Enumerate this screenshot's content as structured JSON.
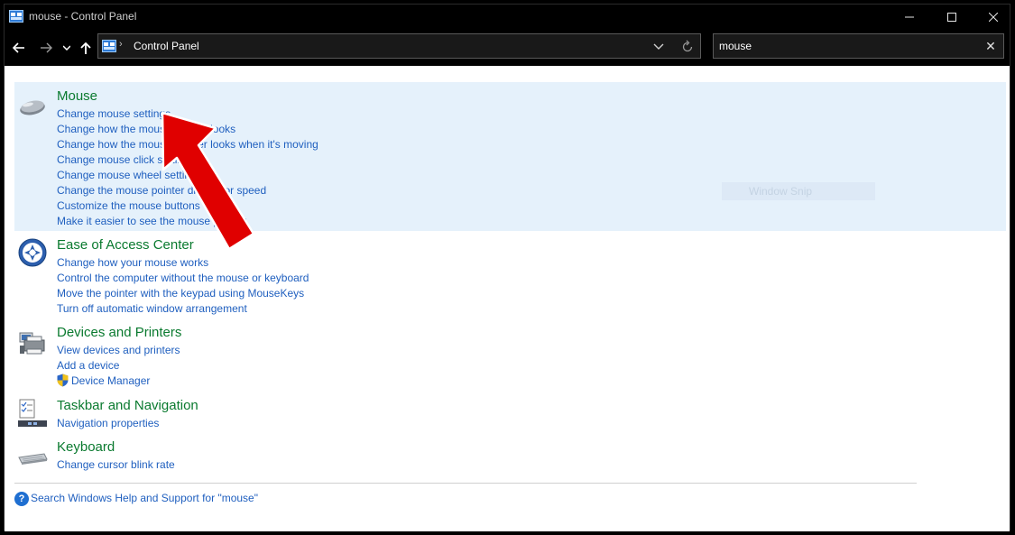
{
  "window": {
    "title": "mouse - Control Panel",
    "accent": "#000000"
  },
  "navbar": {
    "address": "Control Panel",
    "search_value": "mouse",
    "icons": [
      "back-arrow-icon",
      "forward-arrow-icon",
      "chevron-down-icon",
      "up-arrow-icon",
      "control-panel-icon",
      "refresh-icon",
      "close-icon"
    ]
  },
  "results": [
    {
      "title": "Mouse",
      "icon": "mouse-icon",
      "links": [
        "Change mouse settings",
        "Change how the mouse pointer looks",
        "Change how the mouse pointer looks when it's moving",
        "Change mouse click settings",
        "Change mouse wheel settings",
        "Change the mouse pointer display or speed",
        "Customize the mouse buttons",
        "Make it easier to see the mouse pointer"
      ]
    },
    {
      "title": "Ease of Access Center",
      "icon": "ease-of-access-icon",
      "links": [
        "Change how your mouse works",
        "Control the computer without the mouse or keyboard",
        "Move the pointer with the keypad using MouseKeys",
        "Turn off automatic window arrangement"
      ]
    },
    {
      "title": "Devices and Printers",
      "icon": "printer-icon",
      "links": [
        "View devices and printers",
        "Add a device",
        "Device Manager"
      ]
    },
    {
      "title": "Taskbar and Navigation",
      "icon": "taskbar-icon",
      "links": [
        "Navigation properties"
      ]
    },
    {
      "title": "Keyboard",
      "icon": "keyboard-icon",
      "links": [
        "Change cursor blink rate"
      ]
    }
  ],
  "help": {
    "label": "Search Windows Help and Support for \"mouse\""
  },
  "overlay": {
    "faded_text": "Window Snip"
  },
  "colors": {
    "link": "#1f5fbf",
    "group_title": "#0a7a2f",
    "highlight": "#e5f1fb",
    "annotation_arrow": "#e00000"
  }
}
